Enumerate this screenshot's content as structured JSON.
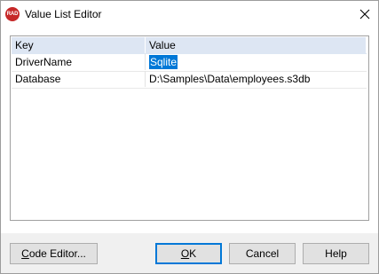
{
  "window": {
    "title": "Value List Editor",
    "app_icon_text": "RAD",
    "close_glyph": "✕"
  },
  "grid": {
    "headers": {
      "key": "Key",
      "value": "Value"
    },
    "rows": [
      {
        "key": "DriverName",
        "value": "Sqlite"
      },
      {
        "key": "Database",
        "value": "D:\\Samples\\Data\\employees.s3db"
      }
    ]
  },
  "buttons": {
    "code_editor": {
      "accel": "C",
      "rest": "ode Editor..."
    },
    "ok": {
      "accel": "O",
      "rest": "K"
    },
    "cancel": "Cancel",
    "help": "Help"
  },
  "colors": {
    "selection": "#0078d7",
    "header_bg": "#dde6f3",
    "app_icon": "#c62828"
  }
}
